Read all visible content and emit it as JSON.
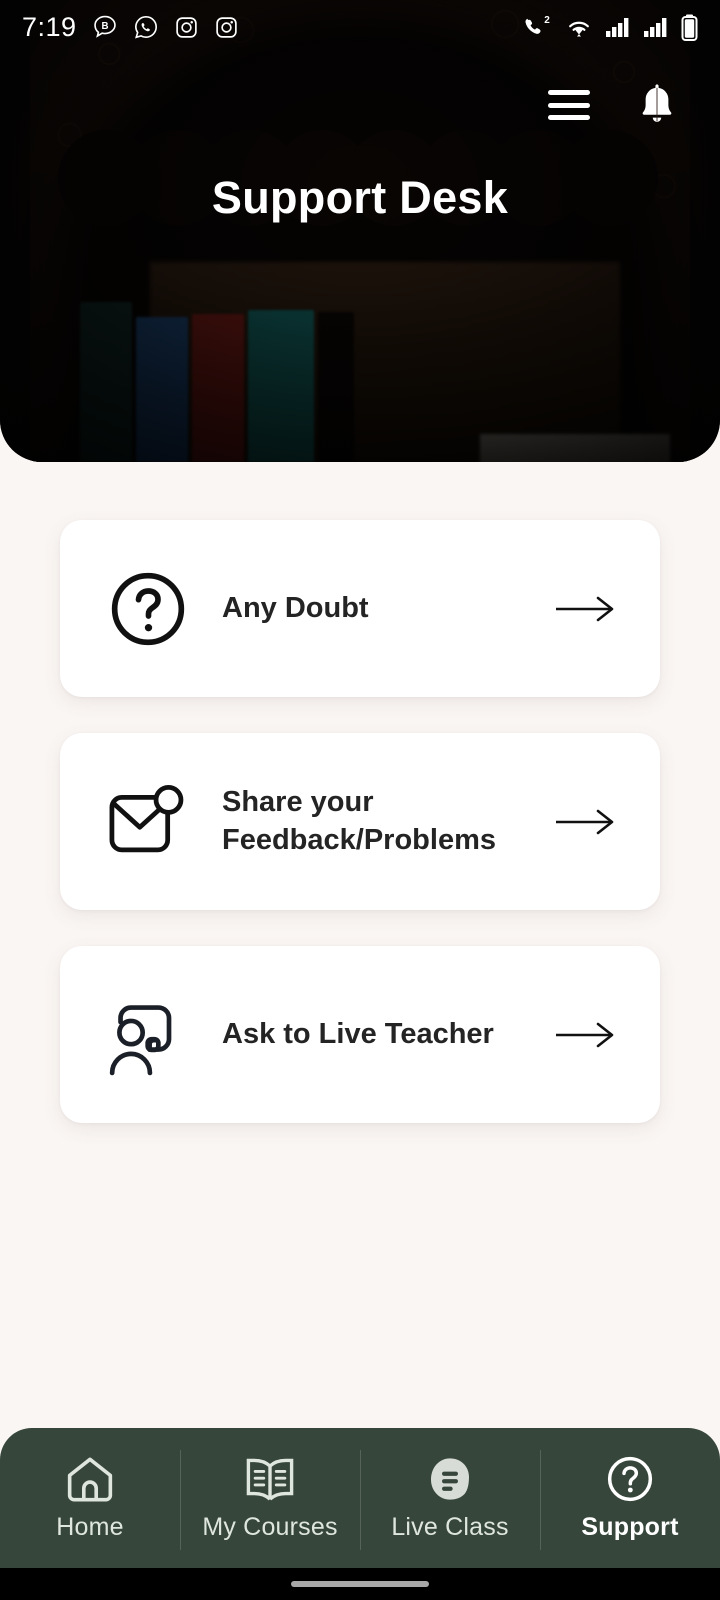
{
  "status_bar": {
    "time": "7:19",
    "left_icons": [
      "bluetooth-message-icon",
      "whatsapp-icon",
      "instagram-icon",
      "instagram-icon"
    ],
    "right_icons": [
      "missed-call-icon",
      "wifi-icon",
      "signal-sim1-icon",
      "signal-sim2-icon",
      "battery-icon"
    ],
    "missed_call_badge": "2"
  },
  "header": {
    "title": "Support Desk",
    "menu_icon": "hamburger-menu-icon",
    "notification_icon": "bell-icon",
    "background_alt": "dark wooden arch bookshelf"
  },
  "cards": [
    {
      "icon": "question-circle-icon",
      "label": "Any Doubt",
      "arrow": "arrow-right-icon"
    },
    {
      "icon": "envelope-notification-icon",
      "label": "Share your Feedback/Problems",
      "arrow": "arrow-right-icon"
    },
    {
      "icon": "person-chat-icon",
      "label": "Ask to Live Teacher",
      "arrow": "arrow-right-icon"
    }
  ],
  "bottom_nav": {
    "items": [
      {
        "label": "Home",
        "icon": "home-icon",
        "active": false
      },
      {
        "label": "My Courses",
        "icon": "open-book-icon",
        "active": false
      },
      {
        "label": "Live Class",
        "icon": "live-class-bubble-icon",
        "active": false
      },
      {
        "label": "Support",
        "icon": "question-circle-icon",
        "active": true
      }
    ]
  },
  "colors": {
    "page_background": "#faf6f4",
    "card_background": "#ffffff",
    "nav_background": "#36463a",
    "nav_text": "#dfe6de",
    "nav_active_text": "#ffffff",
    "card_text": "#242424",
    "header_title": "#ffffff"
  }
}
